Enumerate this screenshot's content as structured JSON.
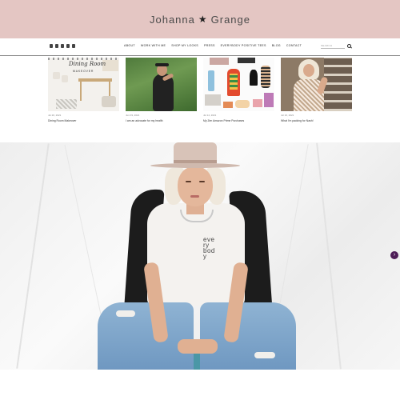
{
  "site": {
    "logo_first": "Johanna",
    "logo_star": "★",
    "logo_last": "Grange"
  },
  "social_icons": [
    "twitter-icon",
    "pinterest-icon",
    "facebook-icon",
    "linkedin-icon",
    "instagram-icon"
  ],
  "nav": {
    "items": [
      "ABOUT",
      "WORK WITH ME",
      "SHOP MY LOOKS",
      "PRESS",
      "EVERYBODY POSITIVE TEES",
      "BLOG",
      "CONTACT"
    ]
  },
  "search": {
    "placeholder": "SEARCH"
  },
  "posts": [
    {
      "date": "Jul 20, 2021",
      "title": "Dining Room Makeover",
      "thumb_heading": "Dining Room",
      "thumb_sub": "MAKEOVER"
    },
    {
      "date": "Jun 03, 2021",
      "title": "I am an advocate for my health"
    },
    {
      "date": "Jul 14, 2021",
      "title": "My Zen Amazon Prime Purchases"
    },
    {
      "date": "Jul 16, 2021",
      "title": "What I'm packing for Nash!"
    }
  ],
  "hero": {
    "shirt_text_lines": [
      "eve",
      "ry",
      "bod",
      "y"
    ]
  },
  "slider": {
    "next_label": "›"
  },
  "colors": {
    "banner": "#e4c6c3",
    "next_button": "#4e1d57"
  }
}
